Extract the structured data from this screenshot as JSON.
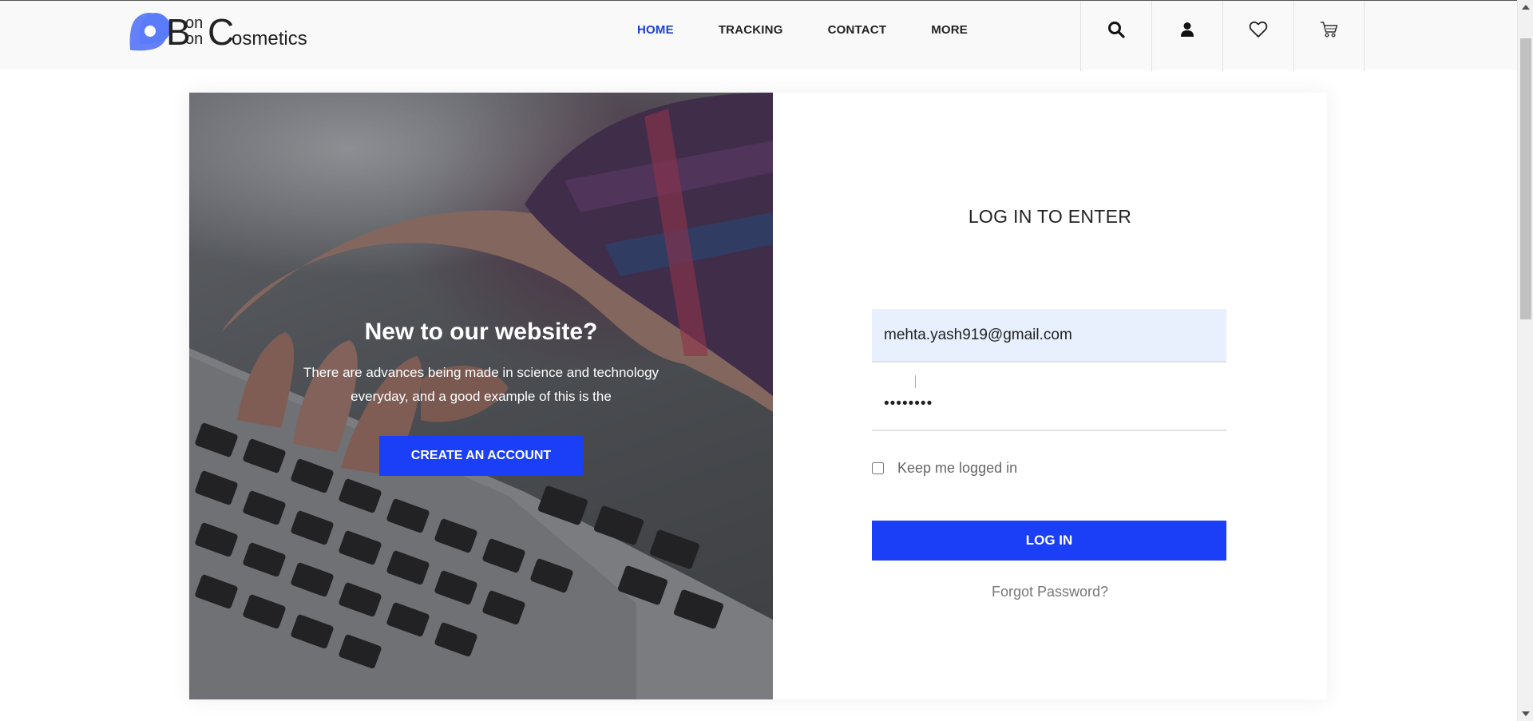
{
  "brand": {
    "logo_b": "B",
    "logo_on_top": "on",
    "logo_on_bottom": "on",
    "logo_c": "C",
    "logo_rest": "osmetics",
    "accent_color": "#1a3ff7",
    "logo_color": "#4a6cf7"
  },
  "nav": {
    "items": [
      {
        "label": "HOME",
        "active": true
      },
      {
        "label": "TRACKING",
        "active": false
      },
      {
        "label": "CONTACT",
        "active": false
      },
      {
        "label": "MORE",
        "active": false
      }
    ]
  },
  "header_icons": [
    "search-icon",
    "user-icon",
    "heart-icon",
    "cart-icon"
  ],
  "hero": {
    "title": "New to our website?",
    "description": "There are advances being made in science and technology everyday, and a good example of this is the",
    "cta_label": "CREATE AN ACCOUNT"
  },
  "login": {
    "title": "LOG IN TO ENTER",
    "email_value": "mehta.yash919@gmail.com",
    "password_value": "••••••••",
    "remember_label": "Keep me logged in",
    "remember_checked": false,
    "submit_label": "LOG IN",
    "forgot_label": "Forgot Password?"
  }
}
